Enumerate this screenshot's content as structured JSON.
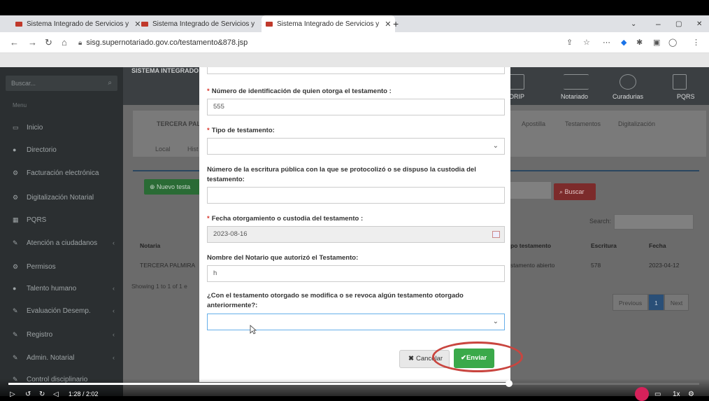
{
  "browser": {
    "tabs": [
      {
        "title": "Sistema Integrado de Servicios y"
      },
      {
        "title": "Sistema Integrado de Servicios y"
      },
      {
        "title": "Sistema Integrado de Servicios y"
      }
    ],
    "url": "sisg.supernotariado.gov.co/testamento&878.jsp"
  },
  "sidebar": {
    "search_placeholder": "Buscar...",
    "menu_title": "Menu",
    "items": [
      {
        "label": "Inicio",
        "icon": "monitor-icon"
      },
      {
        "label": "Directorio",
        "icon": "users-icon"
      },
      {
        "label": "Facturación electrónica",
        "icon": "gears-icon"
      },
      {
        "label": "Digitalización Notarial",
        "icon": "gears-icon"
      },
      {
        "label": "PQRS",
        "icon": "table-icon"
      },
      {
        "label": "Atención a ciudadanos",
        "icon": "tag-icon"
      },
      {
        "label": "Permisos",
        "icon": "gear-icon"
      },
      {
        "label": "Talento humano",
        "icon": "users-icon"
      },
      {
        "label": "Evaluación Desemp.",
        "icon": "tag-icon"
      },
      {
        "label": "Registro",
        "icon": "tag-icon"
      },
      {
        "label": "Admin. Notarial",
        "icon": "tag-icon"
      },
      {
        "label": "Control disciplinario",
        "icon": "tag-icon"
      }
    ]
  },
  "topnav": {
    "system_label": "SISTEMA INTEGRADO",
    "items": [
      "ORIP",
      "Notariado",
      "Curadurias",
      "PQRS"
    ]
  },
  "content": {
    "notary_name": "TERCERA PAL",
    "tabs": [
      "Apostilla",
      "Testamentos",
      "Digitalización"
    ],
    "subtabs": [
      "Local",
      "Hist"
    ],
    "new_button": "Nuevo testa",
    "buscar_button": "Buscar",
    "search_label": "Search:",
    "table": {
      "headers": [
        "Notaria",
        "po testamento",
        "Escritura",
        "Fecha"
      ],
      "row": [
        "TERCERA PALMIRA",
        "stamento abierto",
        "578",
        "2023-04-12"
      ]
    },
    "showing": "Showing 1 to 1 of 1 e",
    "pagination": {
      "previous": "Previous",
      "current": "1",
      "next": "Next"
    }
  },
  "modal": {
    "fields": [
      {
        "label": "Número de identificación de quien otorga el testamento :",
        "required": true,
        "value": "555"
      },
      {
        "label": "Tipo de testamento:",
        "required": true,
        "value": ""
      },
      {
        "label": "Número de la escritura pública con la que se protocolizó o se dispuso la custodia del testamento:",
        "required": false,
        "value": ""
      },
      {
        "label": "Fecha otorgamiento o custodia del testamento :",
        "required": true,
        "value": "2023-08-16"
      },
      {
        "label": "Nombre del Notario que autorizó el Testamento:",
        "required": false,
        "value": "h"
      },
      {
        "label": "¿Con el testamento otorgado se modifica o se revoca algún testamento otorgado anteriormente?:",
        "required": false,
        "value": ""
      }
    ],
    "required_mark": "*",
    "cancel_label": "Cancelar",
    "send_label": "Enviar"
  },
  "video": {
    "time": "1:28 / 2:02",
    "progress_fraction": 0.725,
    "speed": "1x"
  },
  "colors": {
    "send_button": "#3aa94a",
    "highlight_ring": "#c9453f",
    "required": "#d9352b"
  }
}
